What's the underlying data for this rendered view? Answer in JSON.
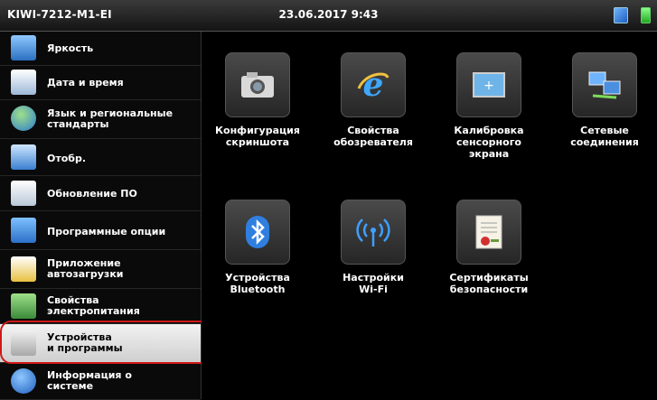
{
  "topbar": {
    "device": "KIWI-7212-M1-EI",
    "datetime": "23.06.2017 9:43"
  },
  "sidebar": {
    "items": [
      {
        "label": "Яркость",
        "icon": "monitor-icon"
      },
      {
        "label": "Дата и время",
        "icon": "calendar-icon"
      },
      {
        "label": "Язык и региональные\nстандарты",
        "icon": "globe-icon"
      },
      {
        "label": "Отобр.",
        "icon": "display-icon"
      },
      {
        "label": "Обновление ПО",
        "icon": "software-update-icon"
      },
      {
        "label": "Программные опции",
        "icon": "puzzle-plus-icon"
      },
      {
        "label": "Приложение\nавтозагрузки",
        "icon": "star-window-icon"
      },
      {
        "label": "Свойства\nэлектропитания",
        "icon": "battery-icon"
      },
      {
        "label": "Устройства\nи программы",
        "icon": "tools-icon",
        "selected": true
      },
      {
        "label": "Информация о\nсистеме",
        "icon": "info-icon"
      }
    ]
  },
  "tiles": [
    {
      "label": "Конфигурация\nскриншота",
      "icon": "camera-icon"
    },
    {
      "label": "Свойства\nобозревателя",
      "icon": "internet-explorer-icon"
    },
    {
      "label": "Калибровка\nсенсорного\nэкрана",
      "icon": "touch-calibration-icon"
    },
    {
      "label": "Сетевые\nсоединения",
      "icon": "network-connections-icon"
    },
    {
      "label": "Устройства\nBluetooth",
      "icon": "bluetooth-icon"
    },
    {
      "label": "Настройки\nWi-Fi",
      "icon": "wifi-icon"
    },
    {
      "label": "Сертификаты\nбезопасности",
      "icon": "certificate-icon"
    }
  ]
}
